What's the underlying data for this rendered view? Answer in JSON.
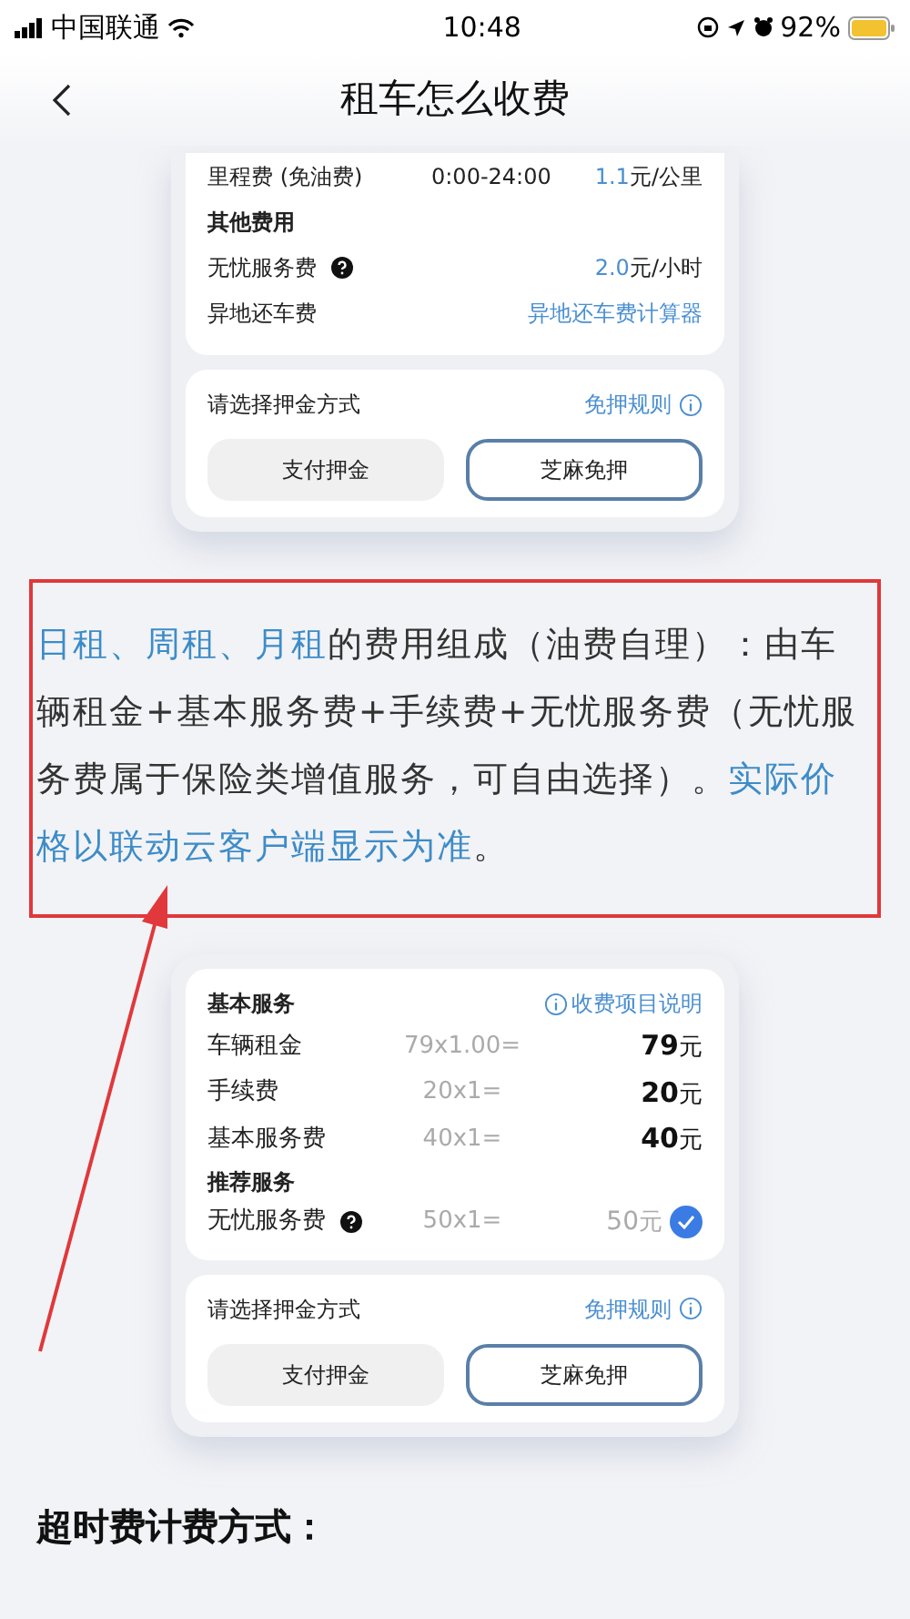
{
  "status_bar": {
    "carrier": "中国联通",
    "time": "10:48",
    "battery": "92%"
  },
  "nav": {
    "title": "租车怎么收费"
  },
  "top_card": {
    "items": [
      {
        "kind": "fee",
        "label": "里程费 (免油费)",
        "middle": "0:00-24:00",
        "value": "1.1",
        "unit": "元/公里"
      },
      {
        "kind": "heading",
        "label": "其他费用"
      },
      {
        "kind": "fee",
        "label": "无忧服务费",
        "help": true,
        "value": "2.0",
        "unit": "元/小时"
      },
      {
        "kind": "link",
        "label": "异地还车费",
        "link": "异地还车费计算器"
      }
    ],
    "deposit": {
      "prompt": "请选择押金方式",
      "rules": "免押规则",
      "options": [
        {
          "label": "支付押金",
          "selected": false
        },
        {
          "label": "芝麻免押",
          "selected": true
        }
      ]
    }
  },
  "note": {
    "segments": [
      {
        "text": "日租、周租、月租",
        "highlight": true
      },
      {
        "text": "的费用组成（油费自理）：由车辆租金+基本服务费+手续费+无忧服务费（无忧服务费属于保险类增值服务，可自由选择）。",
        "highlight": false
      },
      {
        "text": "实际价格以联动云客户端显示为准",
        "highlight": true
      },
      {
        "text": "。",
        "highlight": false
      }
    ]
  },
  "bottom_card": {
    "title": "基本服务",
    "link": "收费项目说明",
    "items": [
      {
        "kind": "line",
        "label": "车辆租金",
        "formula": "79x1.00=",
        "amount": "79",
        "unit": "元"
      },
      {
        "kind": "line",
        "label": "手续费",
        "formula": "20x1=",
        "amount": "20",
        "unit": "元"
      },
      {
        "kind": "line",
        "label": "基本服务费",
        "formula": "40x1=",
        "amount": "40",
        "unit": "元"
      },
      {
        "kind": "heading",
        "label": "推荐服务"
      },
      {
        "kind": "line",
        "label": "无忧服务费",
        "help": true,
        "formula": "50x1=",
        "amount": "50",
        "unit": "元",
        "optional": true,
        "checked": true
      }
    ],
    "deposit": {
      "prompt": "请选择押金方式",
      "rules": "免押规则",
      "options": [
        {
          "label": "支付押金",
          "selected": false
        },
        {
          "label": "芝麻免押",
          "selected": true
        }
      ]
    }
  },
  "section_heading": "超时费计费方式："
}
